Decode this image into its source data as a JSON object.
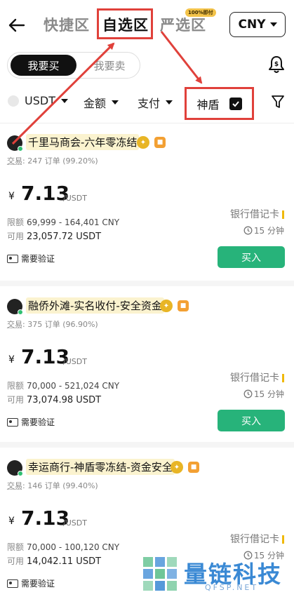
{
  "header": {
    "tabs": [
      {
        "label": "快捷区"
      },
      {
        "label": "自选区"
      },
      {
        "label": "严选区"
      }
    ],
    "promo_badge": "100%即付",
    "currency": "CNY"
  },
  "trade_toggle": {
    "buy": "我要买",
    "sell": "我要卖"
  },
  "filters": {
    "coin": "USDT",
    "amount": "金额",
    "payment": "支付",
    "shield": "神盾",
    "shield_checked": true
  },
  "colors": {
    "highlight": "#e0413b",
    "buy": "#27b37a",
    "online": "#2fbf71"
  },
  "listings": [
    {
      "merchant": "千里马商会-六年零冻结",
      "trades_label": "交易",
      "trades": ": 247 订单 (99.20%)",
      "currency_symbol": "¥",
      "price": "7.13",
      "unit": "/USDT",
      "limit_label": "限额",
      "limit": "69,999 - 164,401 CNY",
      "avail_label": "可用",
      "available": "23,057.72 USDT",
      "payment": "银行借记卡",
      "time_limit": "15 分钟",
      "buy_label": "买入",
      "verify": "需要验证"
    },
    {
      "merchant": "融侨外滩-实名收付-安全资金",
      "trades_label": "交易",
      "trades": ": 375 订单 (96.90%)",
      "currency_symbol": "¥",
      "price": "7.13",
      "unit": "/USDT",
      "limit_label": "限额",
      "limit": "70,000 - 521,024 CNY",
      "avail_label": "可用",
      "available": "73,074.98 USDT",
      "payment": "银行借记卡",
      "time_limit": "15 分钟",
      "buy_label": "买入",
      "verify": "需要验证"
    },
    {
      "merchant": "幸运商行-神盾零冻结-资金安全",
      "trades_label": "交易",
      "trades": ": 146 订单 (99.40%)",
      "currency_symbol": "¥",
      "price": "7.13",
      "unit": "/USDT",
      "limit_label": "限额",
      "limit": "70,000 - 100,120 CNY",
      "avail_label": "可用",
      "available": "14,042.11 USDT",
      "payment": "银行借记卡",
      "time_limit": "15 分钟",
      "buy_label": "买入",
      "verify": "需要验证"
    }
  ],
  "watermark": {
    "title": "量链科技",
    "site": "QFSP.NET"
  }
}
